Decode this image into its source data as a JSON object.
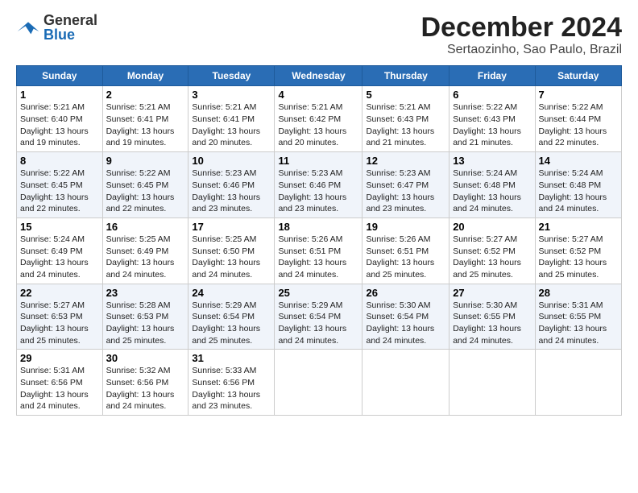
{
  "header": {
    "logo_general": "General",
    "logo_blue": "Blue",
    "title": "December 2024",
    "subtitle": "Sertaozinho, Sao Paulo, Brazil"
  },
  "days_of_week": [
    "Sunday",
    "Monday",
    "Tuesday",
    "Wednesday",
    "Thursday",
    "Friday",
    "Saturday"
  ],
  "weeks": [
    {
      "row_class": "row-odd",
      "days": [
        {
          "num": "1",
          "sunrise": "Sunrise: 5:21 AM",
          "sunset": "Sunset: 6:40 PM",
          "daylight": "Daylight: 13 hours and 19 minutes."
        },
        {
          "num": "2",
          "sunrise": "Sunrise: 5:21 AM",
          "sunset": "Sunset: 6:41 PM",
          "daylight": "Daylight: 13 hours and 19 minutes."
        },
        {
          "num": "3",
          "sunrise": "Sunrise: 5:21 AM",
          "sunset": "Sunset: 6:41 PM",
          "daylight": "Daylight: 13 hours and 20 minutes."
        },
        {
          "num": "4",
          "sunrise": "Sunrise: 5:21 AM",
          "sunset": "Sunset: 6:42 PM",
          "daylight": "Daylight: 13 hours and 20 minutes."
        },
        {
          "num": "5",
          "sunrise": "Sunrise: 5:21 AM",
          "sunset": "Sunset: 6:43 PM",
          "daylight": "Daylight: 13 hours and 21 minutes."
        },
        {
          "num": "6",
          "sunrise": "Sunrise: 5:22 AM",
          "sunset": "Sunset: 6:43 PM",
          "daylight": "Daylight: 13 hours and 21 minutes."
        },
        {
          "num": "7",
          "sunrise": "Sunrise: 5:22 AM",
          "sunset": "Sunset: 6:44 PM",
          "daylight": "Daylight: 13 hours and 22 minutes."
        }
      ]
    },
    {
      "row_class": "row-even",
      "days": [
        {
          "num": "8",
          "sunrise": "Sunrise: 5:22 AM",
          "sunset": "Sunset: 6:45 PM",
          "daylight": "Daylight: 13 hours and 22 minutes."
        },
        {
          "num": "9",
          "sunrise": "Sunrise: 5:22 AM",
          "sunset": "Sunset: 6:45 PM",
          "daylight": "Daylight: 13 hours and 22 minutes."
        },
        {
          "num": "10",
          "sunrise": "Sunrise: 5:23 AM",
          "sunset": "Sunset: 6:46 PM",
          "daylight": "Daylight: 13 hours and 23 minutes."
        },
        {
          "num": "11",
          "sunrise": "Sunrise: 5:23 AM",
          "sunset": "Sunset: 6:46 PM",
          "daylight": "Daylight: 13 hours and 23 minutes."
        },
        {
          "num": "12",
          "sunrise": "Sunrise: 5:23 AM",
          "sunset": "Sunset: 6:47 PM",
          "daylight": "Daylight: 13 hours and 23 minutes."
        },
        {
          "num": "13",
          "sunrise": "Sunrise: 5:24 AM",
          "sunset": "Sunset: 6:48 PM",
          "daylight": "Daylight: 13 hours and 24 minutes."
        },
        {
          "num": "14",
          "sunrise": "Sunrise: 5:24 AM",
          "sunset": "Sunset: 6:48 PM",
          "daylight": "Daylight: 13 hours and 24 minutes."
        }
      ]
    },
    {
      "row_class": "row-odd",
      "days": [
        {
          "num": "15",
          "sunrise": "Sunrise: 5:24 AM",
          "sunset": "Sunset: 6:49 PM",
          "daylight": "Daylight: 13 hours and 24 minutes."
        },
        {
          "num": "16",
          "sunrise": "Sunrise: 5:25 AM",
          "sunset": "Sunset: 6:49 PM",
          "daylight": "Daylight: 13 hours and 24 minutes."
        },
        {
          "num": "17",
          "sunrise": "Sunrise: 5:25 AM",
          "sunset": "Sunset: 6:50 PM",
          "daylight": "Daylight: 13 hours and 24 minutes."
        },
        {
          "num": "18",
          "sunrise": "Sunrise: 5:26 AM",
          "sunset": "Sunset: 6:51 PM",
          "daylight": "Daylight: 13 hours and 24 minutes."
        },
        {
          "num": "19",
          "sunrise": "Sunrise: 5:26 AM",
          "sunset": "Sunset: 6:51 PM",
          "daylight": "Daylight: 13 hours and 25 minutes."
        },
        {
          "num": "20",
          "sunrise": "Sunrise: 5:27 AM",
          "sunset": "Sunset: 6:52 PM",
          "daylight": "Daylight: 13 hours and 25 minutes."
        },
        {
          "num": "21",
          "sunrise": "Sunrise: 5:27 AM",
          "sunset": "Sunset: 6:52 PM",
          "daylight": "Daylight: 13 hours and 25 minutes."
        }
      ]
    },
    {
      "row_class": "row-even",
      "days": [
        {
          "num": "22",
          "sunrise": "Sunrise: 5:27 AM",
          "sunset": "Sunset: 6:53 PM",
          "daylight": "Daylight: 13 hours and 25 minutes."
        },
        {
          "num": "23",
          "sunrise": "Sunrise: 5:28 AM",
          "sunset": "Sunset: 6:53 PM",
          "daylight": "Daylight: 13 hours and 25 minutes."
        },
        {
          "num": "24",
          "sunrise": "Sunrise: 5:29 AM",
          "sunset": "Sunset: 6:54 PM",
          "daylight": "Daylight: 13 hours and 25 minutes."
        },
        {
          "num": "25",
          "sunrise": "Sunrise: 5:29 AM",
          "sunset": "Sunset: 6:54 PM",
          "daylight": "Daylight: 13 hours and 24 minutes."
        },
        {
          "num": "26",
          "sunrise": "Sunrise: 5:30 AM",
          "sunset": "Sunset: 6:54 PM",
          "daylight": "Daylight: 13 hours and 24 minutes."
        },
        {
          "num": "27",
          "sunrise": "Sunrise: 5:30 AM",
          "sunset": "Sunset: 6:55 PM",
          "daylight": "Daylight: 13 hours and 24 minutes."
        },
        {
          "num": "28",
          "sunrise": "Sunrise: 5:31 AM",
          "sunset": "Sunset: 6:55 PM",
          "daylight": "Daylight: 13 hours and 24 minutes."
        }
      ]
    },
    {
      "row_class": "row-last",
      "days": [
        {
          "num": "29",
          "sunrise": "Sunrise: 5:31 AM",
          "sunset": "Sunset: 6:56 PM",
          "daylight": "Daylight: 13 hours and 24 minutes."
        },
        {
          "num": "30",
          "sunrise": "Sunrise: 5:32 AM",
          "sunset": "Sunset: 6:56 PM",
          "daylight": "Daylight: 13 hours and 24 minutes."
        },
        {
          "num": "31",
          "sunrise": "Sunrise: 5:33 AM",
          "sunset": "Sunset: 6:56 PM",
          "daylight": "Daylight: 13 hours and 23 minutes."
        },
        {
          "num": "",
          "sunrise": "",
          "sunset": "",
          "daylight": ""
        },
        {
          "num": "",
          "sunrise": "",
          "sunset": "",
          "daylight": ""
        },
        {
          "num": "",
          "sunrise": "",
          "sunset": "",
          "daylight": ""
        },
        {
          "num": "",
          "sunrise": "",
          "sunset": "",
          "daylight": ""
        }
      ]
    }
  ]
}
